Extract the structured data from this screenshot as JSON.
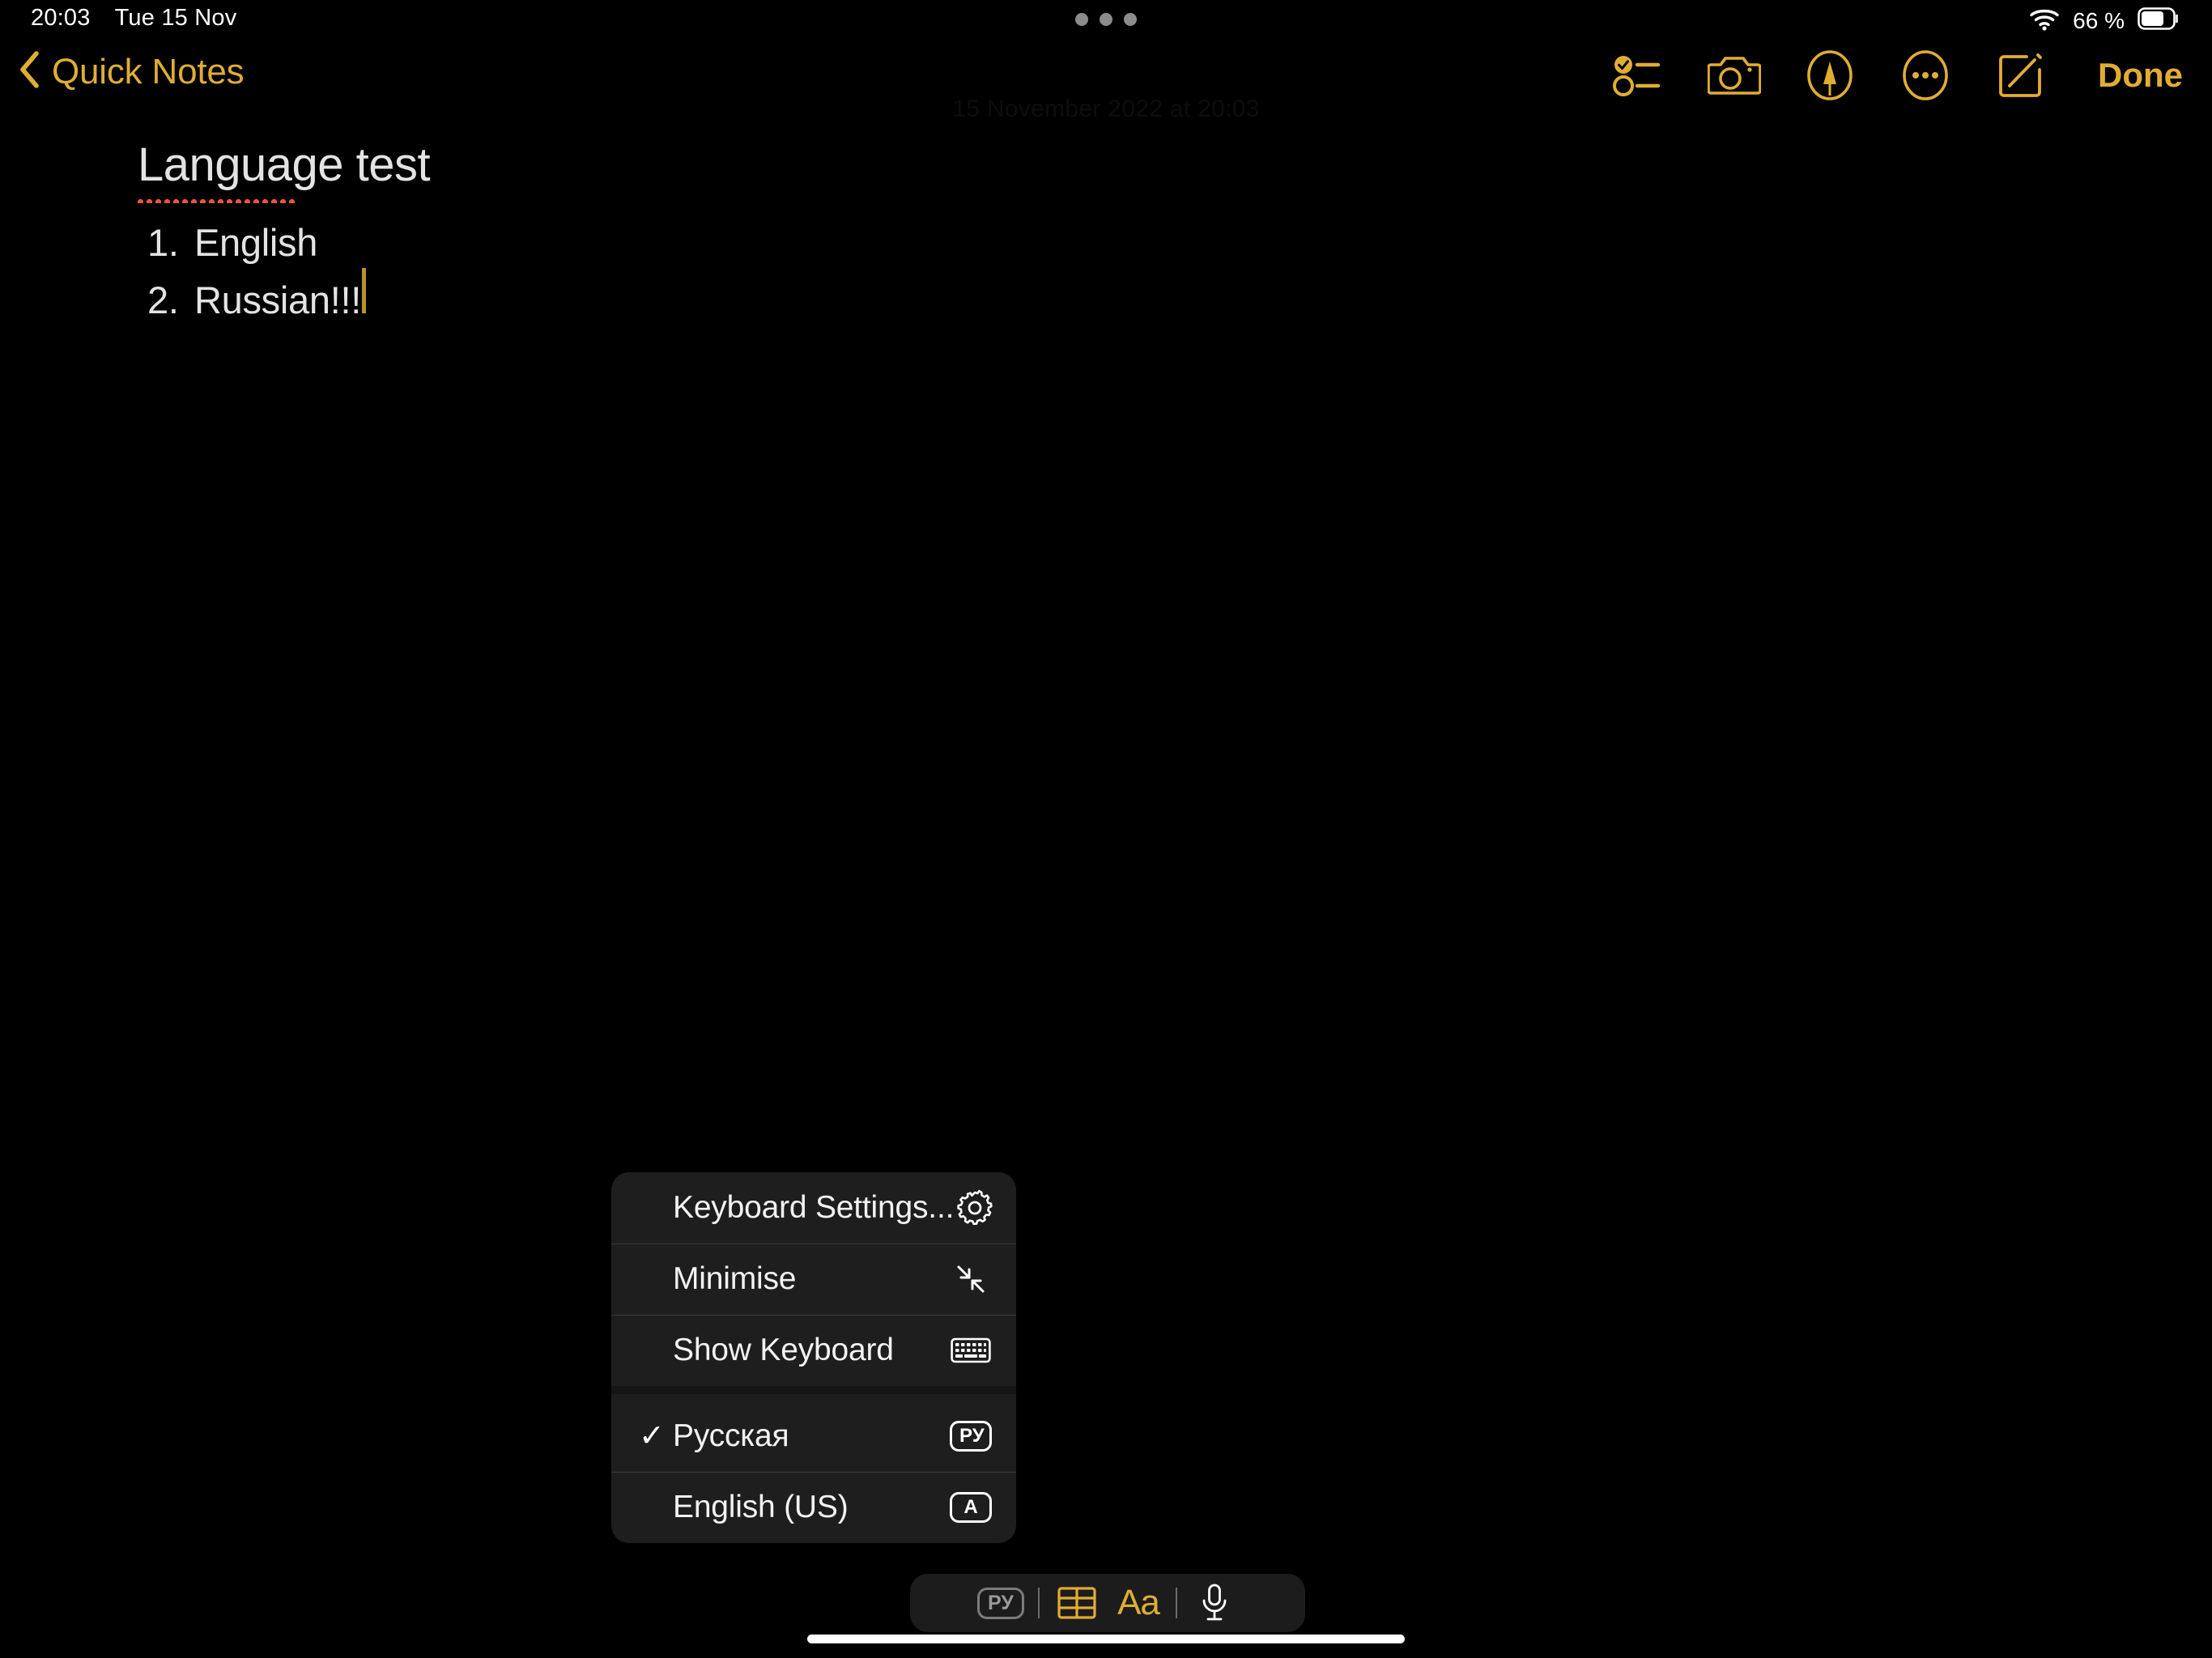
{
  "status_bar": {
    "time": "20:03",
    "date": "Tue 15 Nov",
    "battery_percent": "66 %",
    "wifi_icon": "wifi-icon",
    "battery_icon": "battery-icon",
    "multitask_handle_icon": "multitask-dots-icon"
  },
  "nav_bar": {
    "back_label": "Quick Notes",
    "back_icon": "chevron-left-icon",
    "tools": [
      {
        "name": "checklist-icon",
        "label": "Checklist"
      },
      {
        "name": "camera-icon",
        "label": "Camera"
      },
      {
        "name": "markup-pen-icon",
        "label": "Markup"
      },
      {
        "name": "more-ellipsis-icon",
        "label": "More"
      },
      {
        "name": "compose-icon",
        "label": "New Note"
      }
    ],
    "done_label": "Done",
    "accent_color": "#e0ad34"
  },
  "note": {
    "timestamp": "15 November 2022 at 20:03",
    "title": "Language test",
    "list": [
      {
        "number": "1.",
        "text": "English"
      },
      {
        "number": "2.",
        "text": "Russian!!!"
      }
    ],
    "text_color": "#e3e3e3",
    "spellcheck_color": "#e8543f",
    "caret_color": "#b8922f"
  },
  "keyboard_menu": {
    "items": [
      {
        "label": "Keyboard Settings...",
        "icon": "gear-icon",
        "checked": false,
        "badge": null,
        "section": 0
      },
      {
        "label": "Minimise",
        "icon": "minimise-arrows-icon",
        "checked": false,
        "badge": null,
        "section": 0
      },
      {
        "label": "Show Keyboard",
        "icon": "keyboard-icon",
        "checked": false,
        "badge": null,
        "section": 0
      },
      {
        "label": "Русская",
        "icon": "language-badge-ru-icon",
        "checked": true,
        "badge": "РУ",
        "section": 1
      },
      {
        "label": "English (US)",
        "icon": "language-badge-a-icon",
        "checked": false,
        "badge": "A",
        "section": 1
      }
    ],
    "check_glyph": "✓",
    "background_color": "#1e1e1e"
  },
  "format_toolbar": {
    "language_badge": "РУ",
    "table_icon": "table-icon",
    "text_format_label": "Aa",
    "mic_icon": "microphone-icon",
    "accent_color": "#e0ad34"
  }
}
